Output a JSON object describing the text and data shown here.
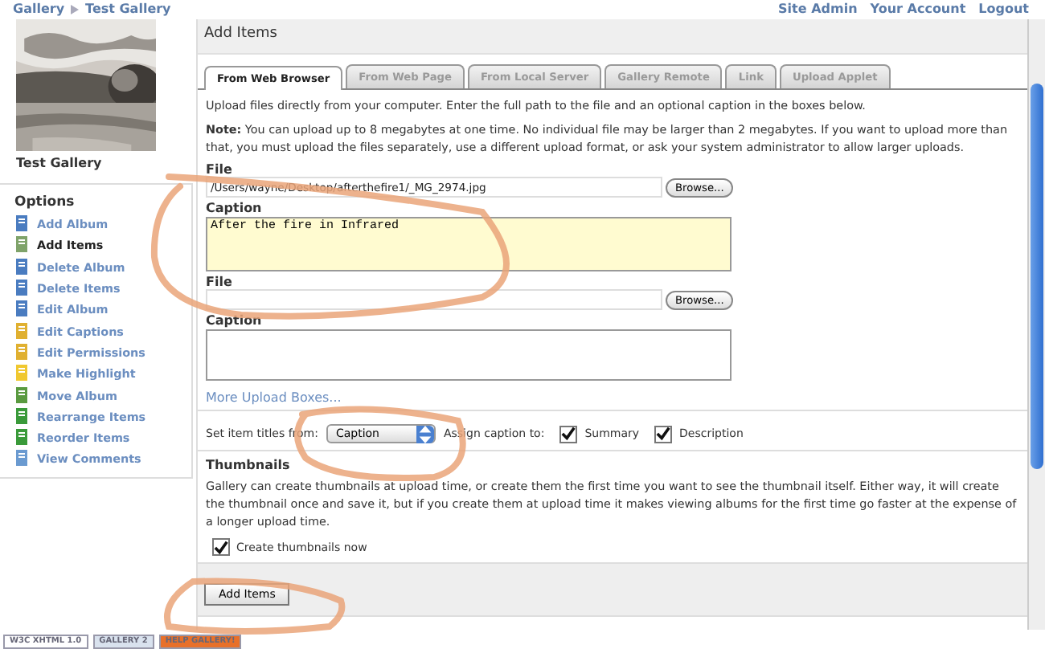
{
  "breadcrumb": [
    "Gallery",
    "Test Gallery"
  ],
  "top_links": [
    "Site Admin",
    "Your Account",
    "Logout"
  ],
  "album": {
    "title": "Test Gallery"
  },
  "sidebar": {
    "heading": "Options",
    "items": [
      {
        "label": "Add Album",
        "selected": false,
        "color": "#4a7cc0"
      },
      {
        "label": "Add Items",
        "selected": true,
        "color": "#7fa36a"
      },
      {
        "label": "Delete Album",
        "selected": false,
        "color": "#4a7cc0"
      },
      {
        "label": "Delete Items",
        "selected": false,
        "color": "#4a7cc0"
      },
      {
        "label": "Edit Album",
        "selected": false,
        "color": "#4a7cc0"
      },
      {
        "label": "Edit Captions",
        "selected": false,
        "color": "#e0b030"
      },
      {
        "label": "Edit Permissions",
        "selected": false,
        "color": "#e0b030"
      },
      {
        "label": "Make Highlight",
        "selected": false,
        "color": "#f0c830"
      },
      {
        "label": "Move Album",
        "selected": false,
        "color": "#5a9a40"
      },
      {
        "label": "Rearrange Items",
        "selected": false,
        "color": "#3a9a3a"
      },
      {
        "label": "Reorder Items",
        "selected": false,
        "color": "#3a9a3a"
      },
      {
        "label": "View Comments",
        "selected": false,
        "color": "#6a9ad0"
      }
    ]
  },
  "page_title": "Add Items",
  "tabs": [
    {
      "label": "From Web Browser",
      "selected": true
    },
    {
      "label": "From Web Page",
      "selected": false
    },
    {
      "label": "From Local Server",
      "selected": false
    },
    {
      "label": "Gallery Remote",
      "selected": false
    },
    {
      "label": "Link",
      "selected": false
    },
    {
      "label": "Upload Applet",
      "selected": false
    }
  ],
  "intro": "Upload files directly from your computer. Enter the full path to the file and an optional caption in the boxes below.",
  "note": "**Note:** You can upload up to 8 megabytes at one time. No individual file may be larger than 2 megabytes. If you want to upload more than that, you must upload the files separately, use a different upload format, or ask your system administrator to allow larger uploads.",
  "uploads": [
    {
      "file_label": "File",
      "file_value": "/Users/wayne/Desktop/afterthefire1/_MG_2974.jpg",
      "browse": "Browse...",
      "caption_label": "Caption",
      "caption_value": "After the fire in Infrared",
      "focused": true
    },
    {
      "file_label": "File",
      "browse": "Browse...",
      "caption_label": "Caption",
      "focused": false
    }
  ],
  "more_link": "More Upload Boxes...",
  "titles_label": "Set item titles from:",
  "titles_value": "Caption",
  "assign_label": "Assign caption to:",
  "assign_options": [
    {
      "label": "Summary",
      "checked": true
    },
    {
      "label": "Description",
      "checked": true
    }
  ],
  "thumbnails": {
    "heading": "Thumbnails",
    "text": "Gallery can create thumbnails at upload time, or create them the first time you want to see the thumbnail itself. Either way, it will create the thumbnail once and save it, but if you create them at upload time it makes viewing albums for the first time go faster at the expense of a longer upload time.",
    "option": {
      "label": "Create thumbnails now",
      "checked": true
    }
  },
  "submit": "Add Items",
  "footer_badges": [
    {
      "label": "W3C XHTML 1.0",
      "color": "#ffffff"
    },
    {
      "label": "GALLERY 2",
      "color": "#d9e2ee"
    },
    {
      "label": "HELP GALLERY!",
      "color": "#e8702a"
    }
  ]
}
